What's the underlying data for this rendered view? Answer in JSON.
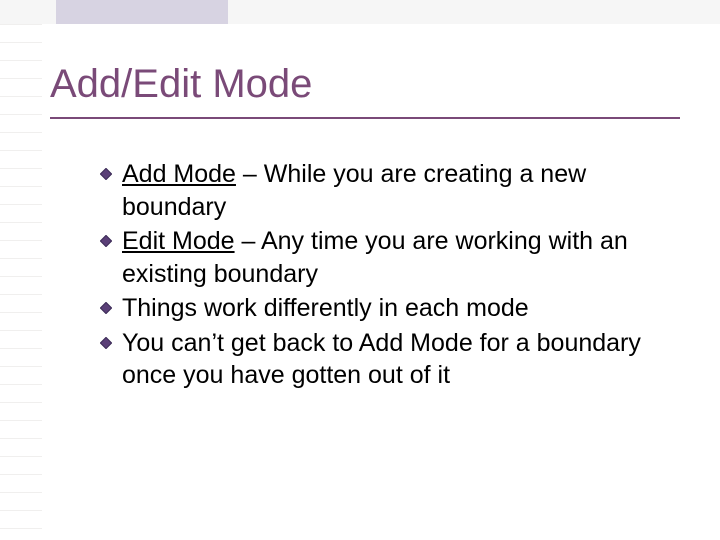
{
  "title": "Add/Edit Mode",
  "bullets": [
    {
      "lead": "Add Mode",
      "rest": " – While you are creating a new boundary"
    },
    {
      "lead": "Edit Mode",
      "rest": " – Any time you are working with an existing boundary"
    },
    {
      "lead": "",
      "rest": "Things work differently in each mode"
    },
    {
      "lead": "",
      "rest": "You can’t get back to Add Mode for a boundary once you have gotten out of it"
    }
  ]
}
